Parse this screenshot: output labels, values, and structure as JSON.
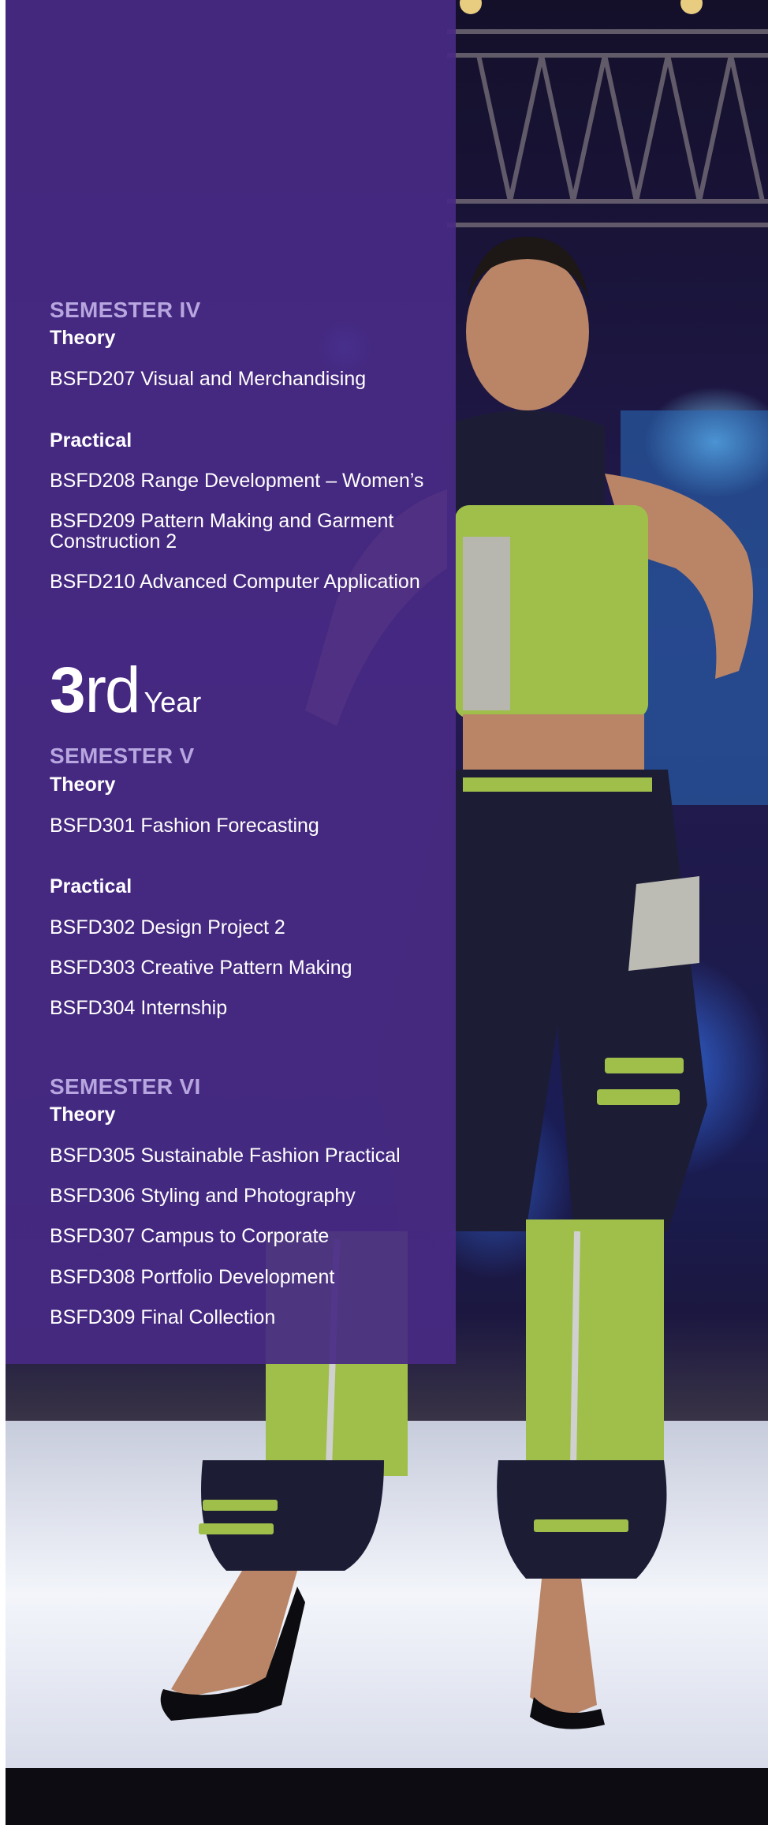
{
  "semester_iv": {
    "title": "SEMESTER IV",
    "theory_label": "Theory",
    "theory_courses": [
      "BSFD207 Visual and Merchandising"
    ],
    "practical_label": "Practical",
    "practical_courses": [
      "BSFD208 Range Development – Women’s",
      "BSFD209 Pattern Making and Garment Construction 2",
      "BSFD210 Advanced Computer Application"
    ]
  },
  "year_heading": {
    "number": "3",
    "suffix": "rd",
    "word": "Year"
  },
  "semester_v": {
    "title": "SEMESTER V",
    "theory_label": "Theory",
    "theory_courses": [
      "BSFD301 Fashion Forecasting"
    ],
    "practical_label": "Practical",
    "practical_courses": [
      "BSFD302 Design Project 2",
      "BSFD303 Creative Pattern Making",
      "BSFD304 Internship"
    ]
  },
  "semester_vi": {
    "title": "SEMESTER VI",
    "theory_label": "Theory",
    "theory_courses": [
      "BSFD305 Sustainable Fashion Practical",
      "BSFD306 Styling and Photography",
      "BSFD307 Campus to Corporate",
      "BSFD308 Portfolio Development",
      "BSFD309 Final Collection"
    ]
  },
  "colors": {
    "panel": "#482a84",
    "semester_title": "#b7a6df",
    "text": "#ffffff",
    "garment_green": "#9fbf4a",
    "garment_navy": "#1c1d35"
  }
}
